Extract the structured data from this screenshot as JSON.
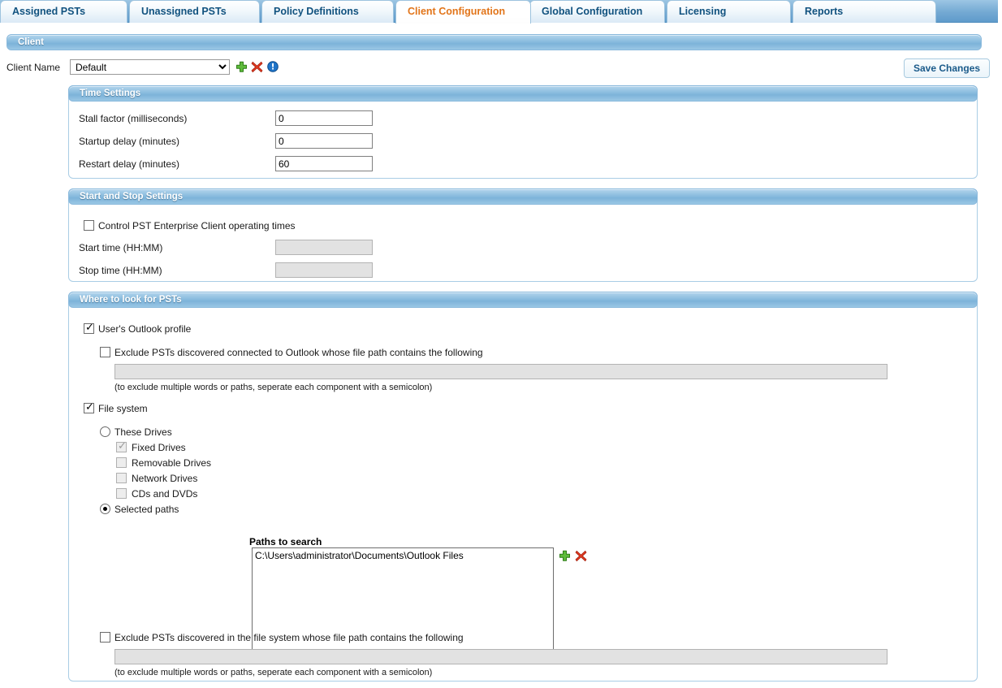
{
  "tabs": [
    {
      "label": "Assigned PSTs",
      "active": false
    },
    {
      "label": "Unassigned PSTs",
      "active": false
    },
    {
      "label": "Policy Definitions",
      "active": false
    },
    {
      "label": "Client Configuration",
      "active": true
    },
    {
      "label": "Global Configuration",
      "active": false
    },
    {
      "label": "Licensing",
      "active": false
    },
    {
      "label": "Reports",
      "active": false
    }
  ],
  "client_panel": {
    "title": "Client",
    "client_name_label": "Client Name",
    "client_name_value": "Default",
    "client_name_options": [
      "Default"
    ],
    "add_icon": "plus-icon",
    "delete_icon": "delete-x-icon",
    "info_icon": "info-icon",
    "save_label": "Save Changes"
  },
  "time_settings": {
    "title": "Time Settings",
    "rows": [
      {
        "label": "Stall factor (milliseconds)",
        "value": "0"
      },
      {
        "label": "Startup delay (minutes)",
        "value": "0"
      },
      {
        "label": "Restart delay (minutes)",
        "value": "60"
      }
    ]
  },
  "start_stop_settings": {
    "title": "Start and Stop Settings",
    "control_times_label": "Control PST Enterprise Client operating times",
    "control_times_checked": false,
    "start_time_label": "Start time (HH:MM)",
    "start_time_value": "",
    "stop_time_label": "Stop time (HH:MM)",
    "stop_time_value": ""
  },
  "where_to_look": {
    "title": "Where to look for PSTs",
    "outlook_profile_label": "User's Outlook profile",
    "outlook_profile_checked": true,
    "exclude_outlook_label": "Exclude PSTs discovered connected to Outlook whose file path contains the following",
    "exclude_outlook_checked": false,
    "exclude_outlook_value": "",
    "exclude_outlook_hint": "(to exclude multiple words or paths, seperate each component with a semicolon)",
    "file_system_label": "File system",
    "file_system_checked": true,
    "these_drives_label": "These Drives",
    "these_drives_selected": false,
    "drives": [
      {
        "label": "Fixed Drives",
        "checked": true,
        "disabled": true
      },
      {
        "label": "Removable Drives",
        "checked": false,
        "disabled": true
      },
      {
        "label": "Network Drives",
        "checked": false,
        "disabled": true
      },
      {
        "label": "CDs and DVDs",
        "checked": false,
        "disabled": true
      }
    ],
    "selected_paths_label": "Selected paths",
    "selected_paths_selected": true,
    "paths_to_search_label": "Paths to search",
    "paths": [
      "C:\\Users\\administrator\\Documents\\Outlook Files"
    ],
    "path_add_icon": "plus-icon",
    "path_delete_icon": "delete-x-icon",
    "exclude_fs_label": "Exclude PSTs discovered in the file system whose file path contains the following",
    "exclude_fs_checked": false,
    "exclude_fs_value": "",
    "exclude_fs_hint": "(to exclude multiple words or paths, seperate each component with a semicolon)"
  },
  "colors": {
    "accent_blue": "#74a9d3",
    "active_tab_text": "#e2751a",
    "tab_text": "#11527f",
    "panel_border": "#a9cde5",
    "disabled_field": "#e2e2e2"
  }
}
